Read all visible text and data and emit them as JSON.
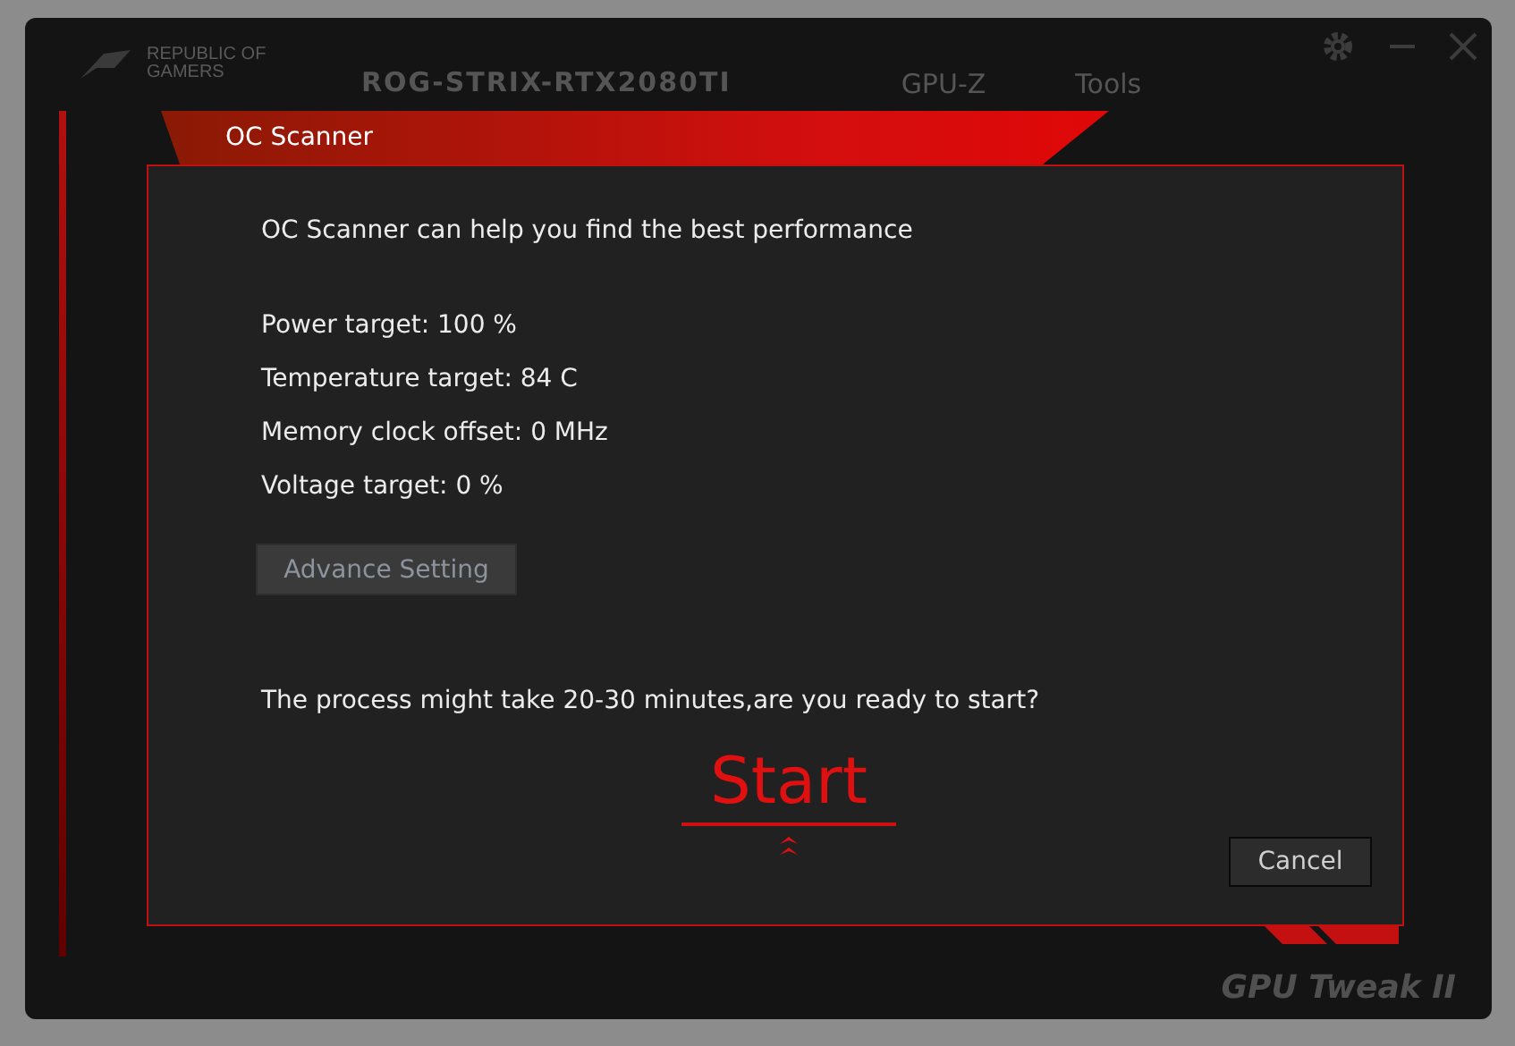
{
  "app": {
    "brand": "REPUBLIC OF GAMERS",
    "device": "ROG-STRIX-RTX2080TI",
    "nav": [
      "GPU-Z",
      "Tools"
    ],
    "footer_brand": "GPU Tweak II"
  },
  "dialog": {
    "title": "OC Scanner",
    "intro": "OC Scanner can help you find the best performance",
    "settings": [
      "Power target: 100 %",
      "Temperature target: 84 C",
      "Memory clock offset: 0 MHz",
      "Voltage target: 0 %"
    ],
    "advance_button": "Advance Setting",
    "question": "The process might take 20-30 minutes,are you ready to start?",
    "start_button": "Start",
    "cancel_button": "Cancel"
  }
}
